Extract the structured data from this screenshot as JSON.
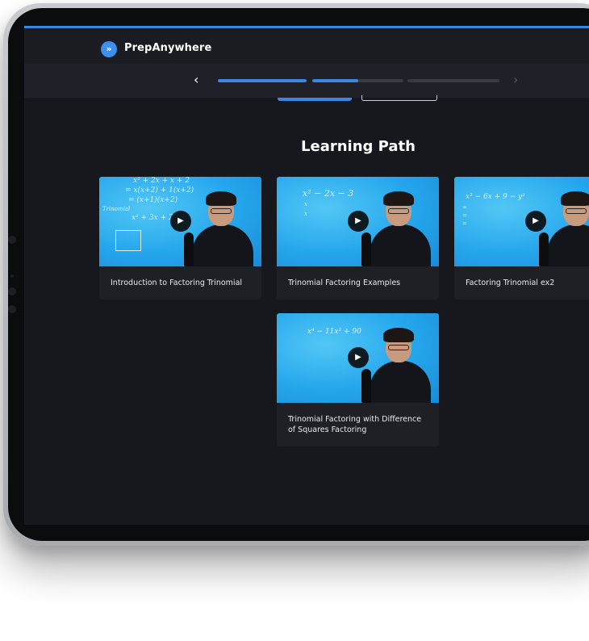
{
  "app": {
    "brand": "PrepAnywhere",
    "brand_icon": "double-chevron-right-icon",
    "accent": "#3a86e0"
  },
  "progress": {
    "prev_icon": "chevron-left-icon",
    "next_icon": "chevron-right-icon",
    "segments": [
      1.0,
      0.5,
      0.0
    ]
  },
  "section": {
    "title": "Learning Path"
  },
  "videos": [
    {
      "title": "Introduction to Factoring Trinomial",
      "play_icon": "play-icon",
      "board": [
        "x² + 2x + x + 2",
        "= x(x+2) + 1(x+2)",
        "= (x+1)(x+2)",
        "Trinomial",
        "x² + 3x + 2"
      ]
    },
    {
      "title": "Trinomial Factoring Examples",
      "play_icon": "play-icon",
      "board": [
        "x² − 2x − 3",
        "x",
        "x"
      ]
    },
    {
      "title": "Factoring Trinomial ex2",
      "play_icon": "play-icon",
      "board": [
        "x² − 6x + 9 − y²",
        "=",
        "=",
        "="
      ]
    },
    {
      "title": "Trinomial Factoring with Difference of Squares Factoring",
      "play_icon": "play-icon",
      "board": [
        "x⁴ − 11x² + 90"
      ]
    }
  ]
}
